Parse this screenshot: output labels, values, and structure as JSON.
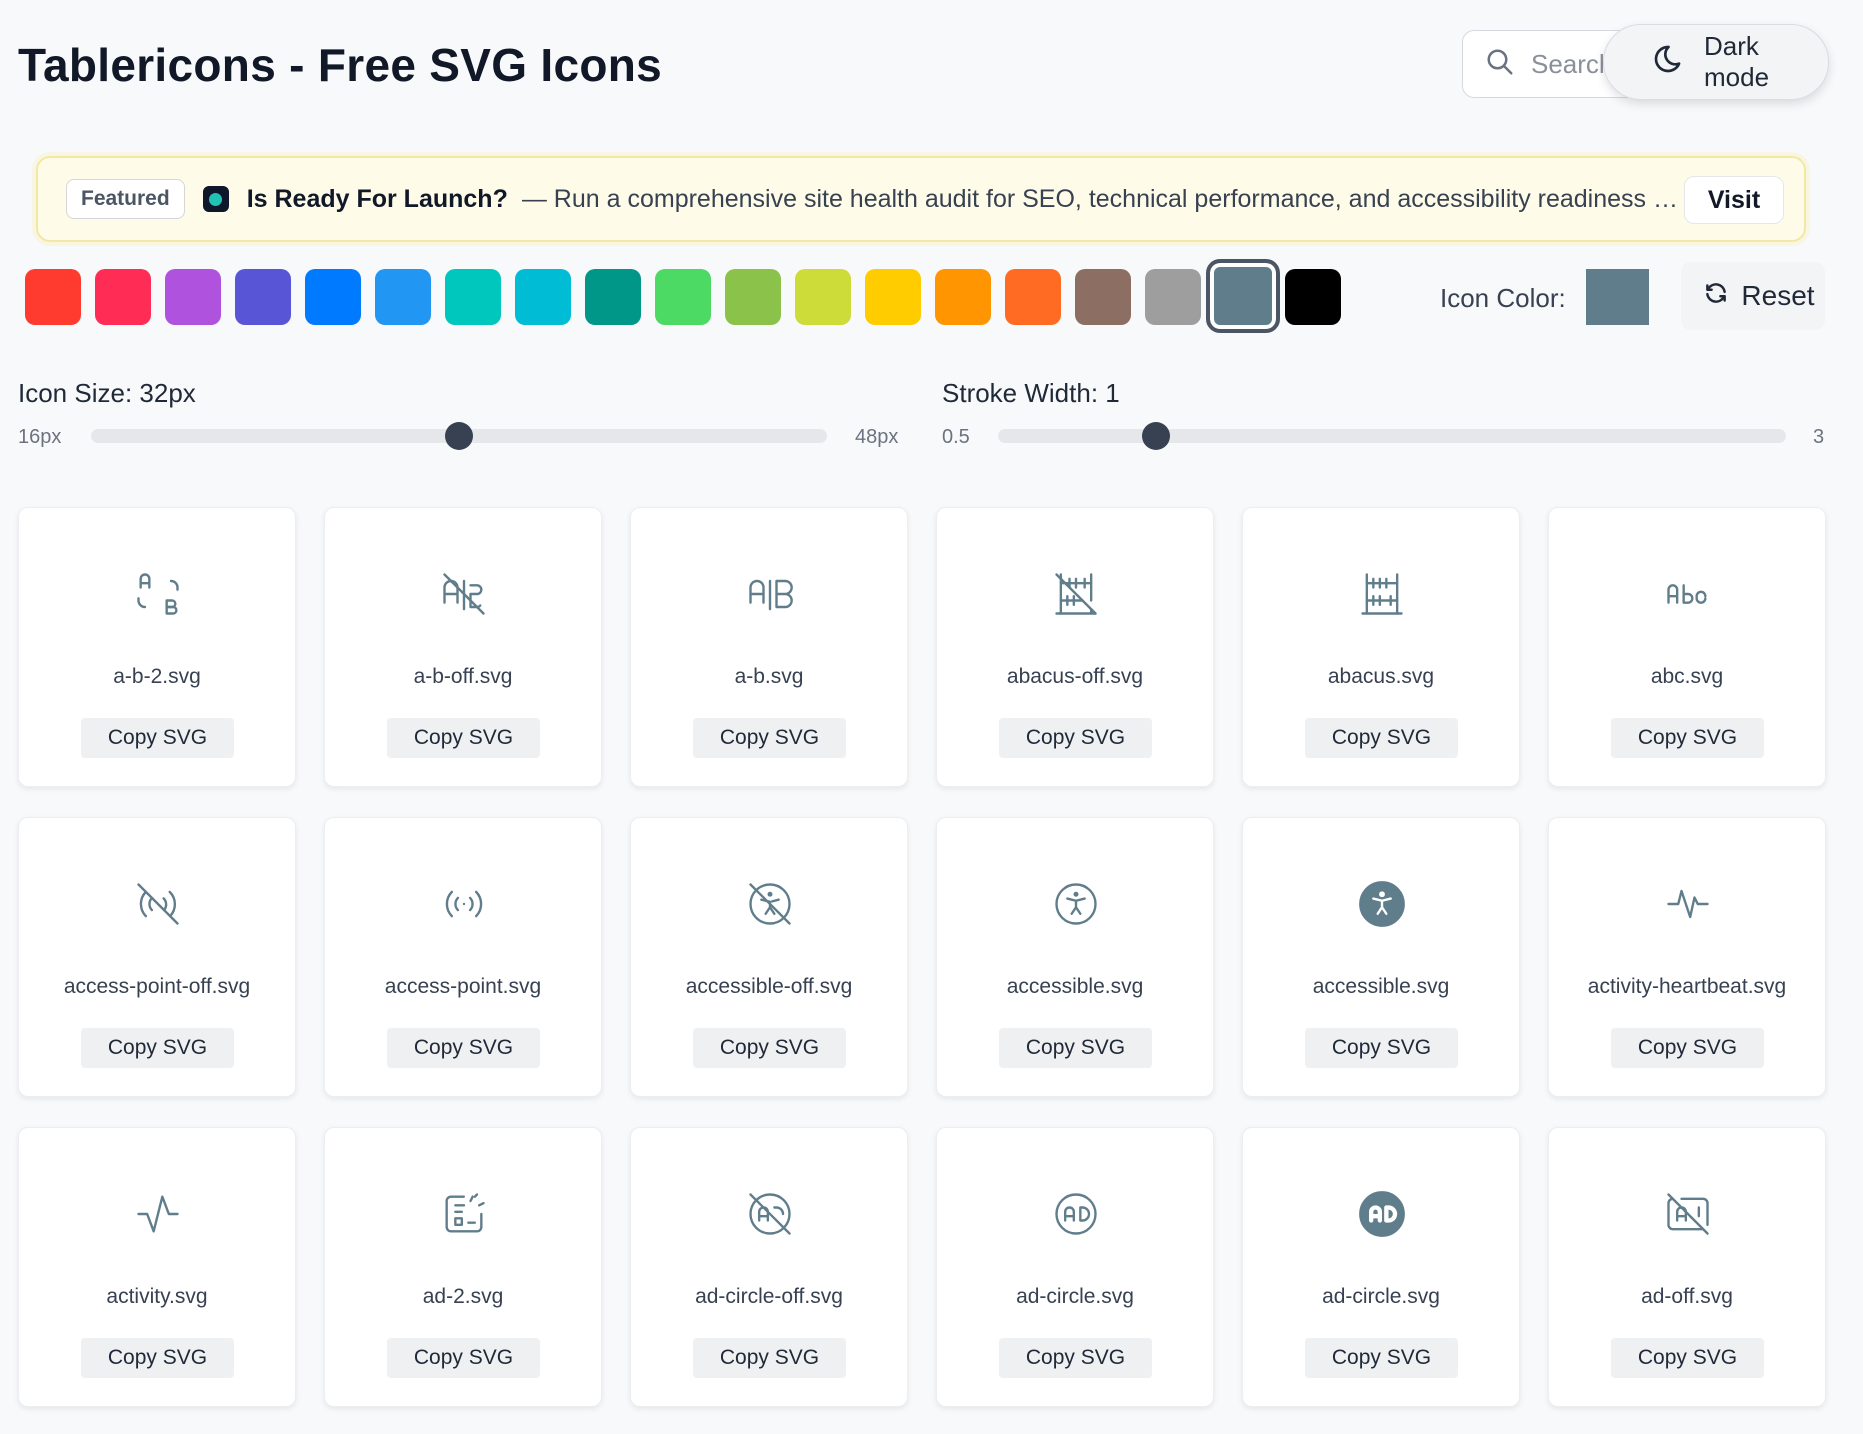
{
  "header": {
    "title": "Tablericons - Free SVG Icons",
    "search_placeholder": "Search icons...",
    "dark_mode_label": "Dark mode"
  },
  "banner": {
    "badge": "Featured",
    "title": "Is Ready For Launch?",
    "text": "— Run a comprehensive site health audit for SEO, technical performance, and accessibility readiness b...",
    "visit_label": "Visit"
  },
  "palette": {
    "colors": [
      "#ff3b30",
      "#ff2d55",
      "#af52de",
      "#5856d6",
      "#007aff",
      "#2196f3",
      "#00c7be",
      "#00bcd4",
      "#009688",
      "#4cd964",
      "#8bc34a",
      "#cddc39",
      "#ffcc00",
      "#ff9500",
      "#ff6b22",
      "#8d6e63",
      "#9e9e9e",
      "#607d8b",
      "#000000"
    ],
    "selected_index": 17,
    "icon_color_label": "Icon Color:",
    "icon_color_value": "#607d8b",
    "reset_label": "Reset"
  },
  "size_slider": {
    "label": "Icon Size: 32px",
    "min_label": "16px",
    "max_label": "48px",
    "min": 16,
    "max": 48,
    "value": 32
  },
  "stroke_slider": {
    "label": "Stroke Width: 1",
    "min_label": "0.5",
    "max_label": "3",
    "min": 0.5,
    "max": 3,
    "value": 1
  },
  "copy_label": "Copy SVG",
  "icons": [
    {
      "file": "a-b-2.svg",
      "icon": "a-b-2-icon"
    },
    {
      "file": "a-b-off.svg",
      "icon": "a-b-off-icon"
    },
    {
      "file": "a-b.svg",
      "icon": "a-b-icon"
    },
    {
      "file": "abacus-off.svg",
      "icon": "abacus-off-icon"
    },
    {
      "file": "abacus.svg",
      "icon": "abacus-icon"
    },
    {
      "file": "abc.svg",
      "icon": "abc-icon"
    },
    {
      "file": "access-point-off.svg",
      "icon": "access-point-off-icon"
    },
    {
      "file": "access-point.svg",
      "icon": "access-point-icon"
    },
    {
      "file": "accessible-off.svg",
      "icon": "accessible-off-icon"
    },
    {
      "file": "accessible.svg",
      "icon": "accessible-icon"
    },
    {
      "file": "accessible.svg",
      "icon": "accessible-filled-icon"
    },
    {
      "file": "activity-heartbeat.svg",
      "icon": "activity-heartbeat-icon"
    },
    {
      "file": "activity.svg",
      "icon": "activity-icon"
    },
    {
      "file": "ad-2.svg",
      "icon": "ad-2-icon"
    },
    {
      "file": "ad-circle-off.svg",
      "icon": "ad-circle-off-icon"
    },
    {
      "file": "ad-circle.svg",
      "icon": "ad-circle-icon"
    },
    {
      "file": "ad-circle.svg",
      "icon": "ad-circle-filled-icon"
    },
    {
      "file": "ad-off.svg",
      "icon": "ad-off-icon"
    }
  ]
}
